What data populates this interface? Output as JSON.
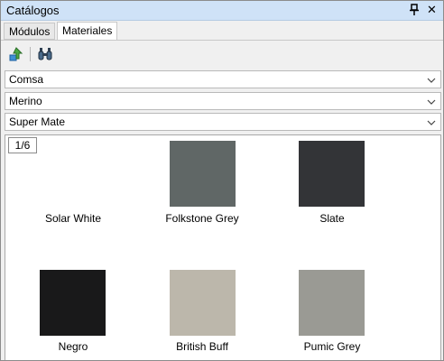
{
  "window": {
    "title": "Catálogos",
    "pin_icon": "pin-icon",
    "close_glyph": "✕"
  },
  "tabs": [
    {
      "label": "Módulos",
      "active": false
    },
    {
      "label": "Materiales",
      "active": true
    }
  ],
  "toolbar": {
    "buttons": [
      {
        "icon": "import-icon"
      },
      {
        "icon": "binoculars-icon"
      }
    ]
  },
  "filters": {
    "manufacturer": "Comsa",
    "collection": "Merino",
    "finish": "Super Mate"
  },
  "gallery": {
    "page_indicator": "1/6",
    "materials": [
      {
        "name": "Solar White",
        "color": "#ffffff"
      },
      {
        "name": "Folkstone Grey",
        "color": "#606766"
      },
      {
        "name": "Slate",
        "color": "#333437"
      },
      {
        "name": "Negro",
        "color": "#19191a"
      },
      {
        "name": "British Buff",
        "color": "#bcb7ab"
      },
      {
        "name": "Pumic Grey",
        "color": "#9a9a94"
      }
    ]
  }
}
